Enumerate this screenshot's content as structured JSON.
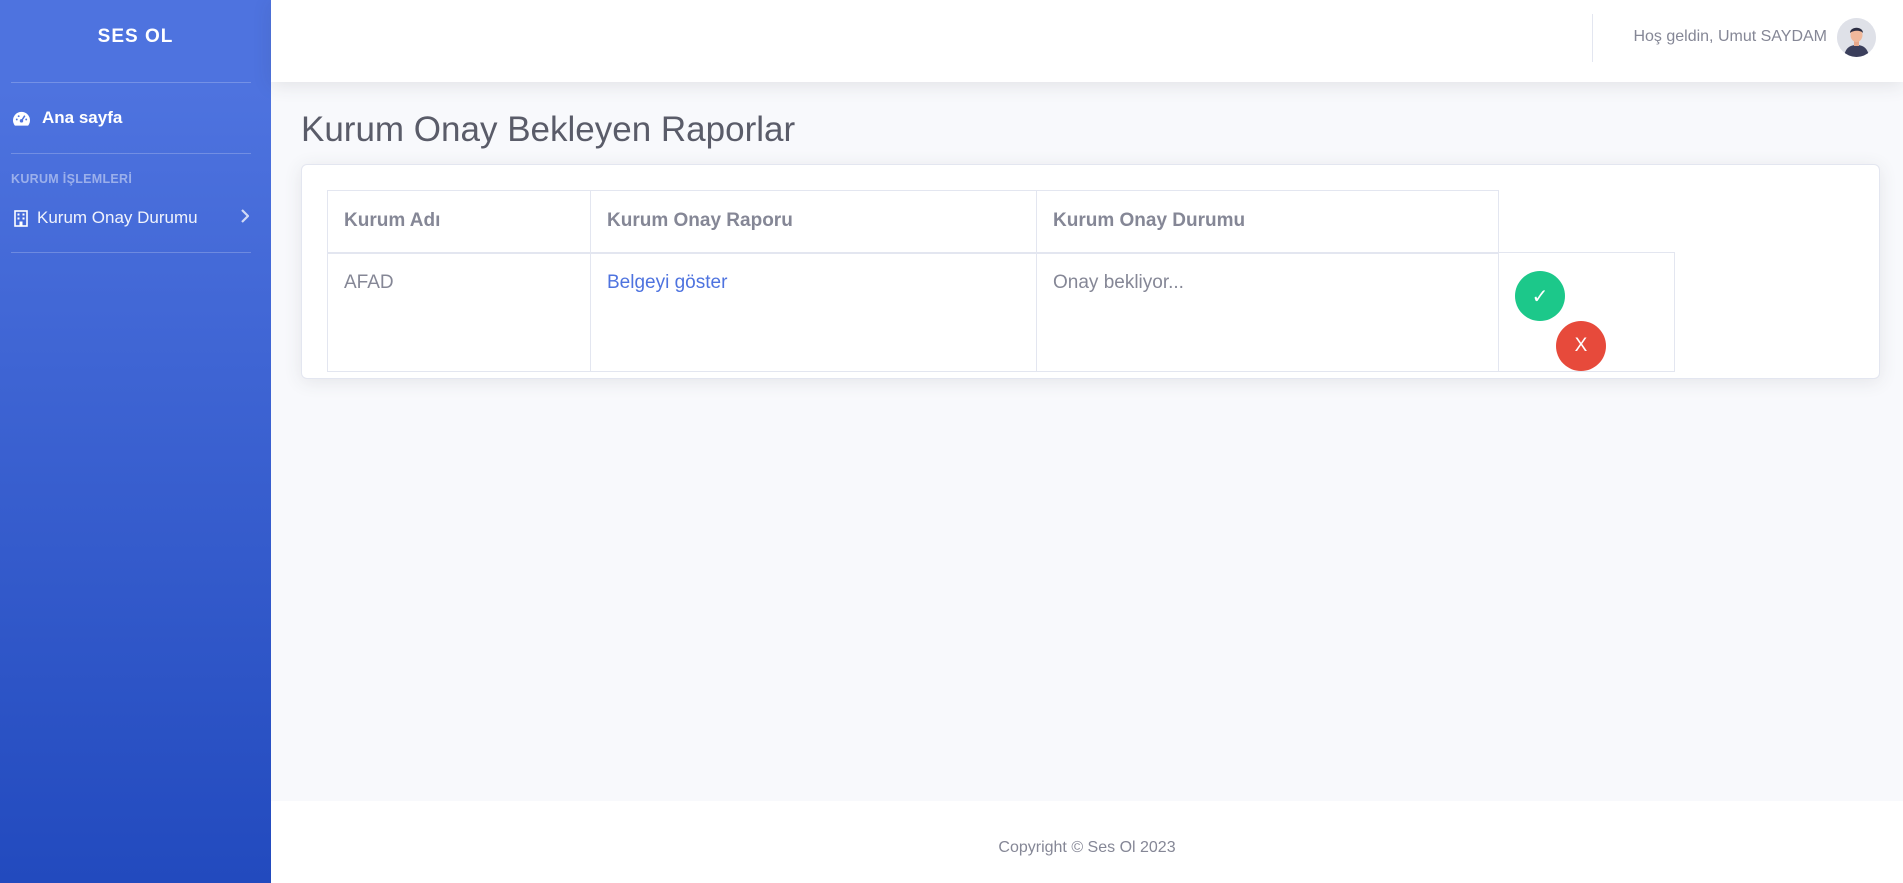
{
  "sidebar": {
    "brand": "SES OL",
    "items": [
      {
        "label": "Ana sayfa",
        "icon": "tachometer-icon"
      },
      {
        "label": "Kurum Onay Durumu",
        "icon": "building-icon"
      }
    ],
    "section_heading": "KURUM İŞLEMLERİ"
  },
  "topbar": {
    "welcome": "Hoş geldin, Umut SAYDAM",
    "avatar_icon": "user-avatar-icon"
  },
  "main": {
    "title": "Kurum Onay Bekleyen Raporlar",
    "table": {
      "headers": [
        "Kurum Adı",
        "Kurum Onay Raporu",
        "Kurum Onay Durumu"
      ],
      "rows": [
        {
          "name": "AFAD",
          "report_link": "Belgeyi göster",
          "status": "Onay bekliyor...",
          "approve_label": "✓",
          "reject_label": "X"
        }
      ]
    }
  },
  "footer": {
    "copyright": "Copyright © Ses Ol 2023"
  },
  "colors": {
    "sidebar_top": "#4e73df",
    "sidebar_bottom": "#224abe",
    "approve": "#1cc88a",
    "reject": "#e74a3b",
    "link": "#4e73df"
  }
}
